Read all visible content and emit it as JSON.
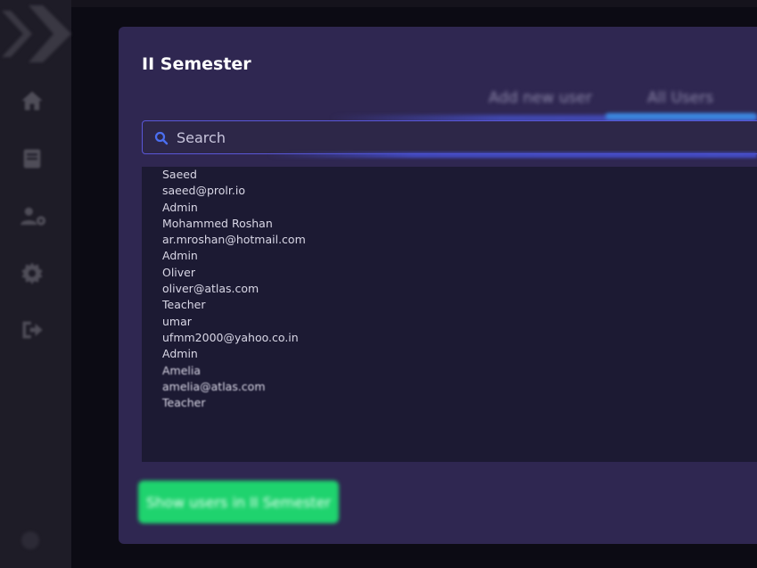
{
  "panel": {
    "title": "II Semester",
    "tabs": [
      {
        "label": "Add new user",
        "active": false
      },
      {
        "label": "All Users",
        "active": true
      }
    ],
    "search": {
      "placeholder": "Search",
      "value": ""
    },
    "users": [
      {
        "name": "Saeed",
        "email": "saeed@prolr.io",
        "role": "Admin"
      },
      {
        "name": "Mohammed Roshan",
        "email": "ar.mroshan@hotmail.com",
        "role": "Admin"
      },
      {
        "name": "Oliver",
        "email": "oliver@atlas.com",
        "role": "Teacher"
      },
      {
        "name": "umar",
        "email": "ufmm2000@yahoo.co.in",
        "role": "Admin"
      },
      {
        "name": "Amelia",
        "email": "amelia@atlas.com",
        "role": "Teacher"
      }
    ],
    "show_button": "Show users in II Semester"
  },
  "sidebar": {
    "items": [
      "home-icon",
      "book-icon",
      "users-cog-icon",
      "gear-icon",
      "sign-out-icon"
    ]
  },
  "colors": {
    "panel": "#2f2751",
    "list_bg": "#1c1a33",
    "accent_blue": "#3a8ae0",
    "button_green": "#1fd36e"
  }
}
